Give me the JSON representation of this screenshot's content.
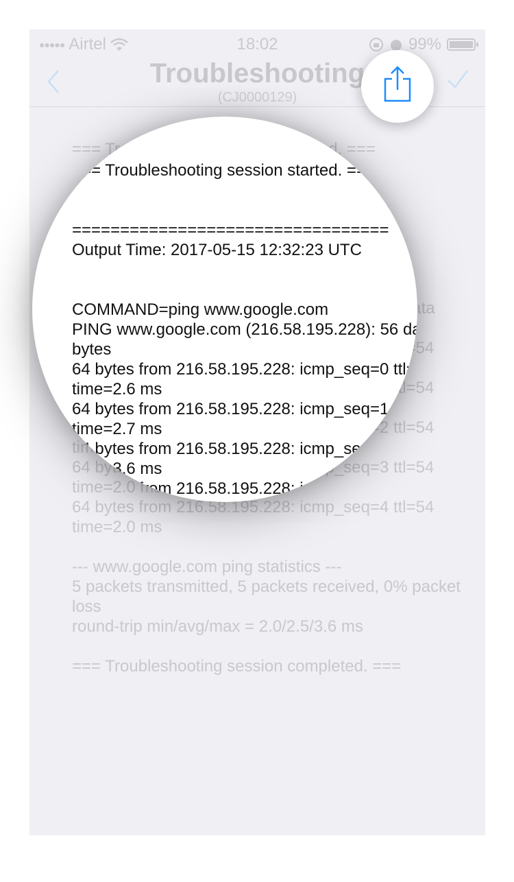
{
  "status_bar": {
    "carrier": "Airtel",
    "time": "18:02",
    "battery": "99%"
  },
  "nav": {
    "back_icon": "chevron-left-icon",
    "title": "Troubleshooting",
    "subtitle": "(CJ0000129)",
    "share_icon": "share-icon",
    "done_icon": "checkmark-icon"
  },
  "colors": {
    "accent": "#1a8cff",
    "background": "#efeff4"
  },
  "log_lines": [
    "=== Troubleshooting session started. ===",
    "",
    "",
    "=================================",
    "Output Time: 2017-05-15 12:32:23 UTC",
    "",
    "",
    "COMMAND=ping www.google.com",
    "PING www.google.com (216.58.195.228): 56 data bytes",
    "64 bytes from 216.58.195.228: icmp_seq=0 ttl=54 time=2.6 ms",
    "64 bytes from 216.58.195.228: icmp_seq=1 ttl=54 time=2.7 ms",
    "64 bytes from 216.58.195.228: icmp_seq=2 ttl=54 time=3.6 ms",
    "64 bytes from 216.58.195.228: icmp_seq=3 ttl=54 time=2.0 ms",
    "64 bytes from 216.58.195.228: icmp_seq=4 ttl=54 time=2.0 ms",
    "",
    "--- www.google.com ping statistics ---",
    "5 packets transmitted, 5 packets received, 0% packet loss",
    "round-trip min/avg/max = 2.0/2.5/3.6 ms",
    "",
    "=== Troubleshooting session completed. ==="
  ]
}
